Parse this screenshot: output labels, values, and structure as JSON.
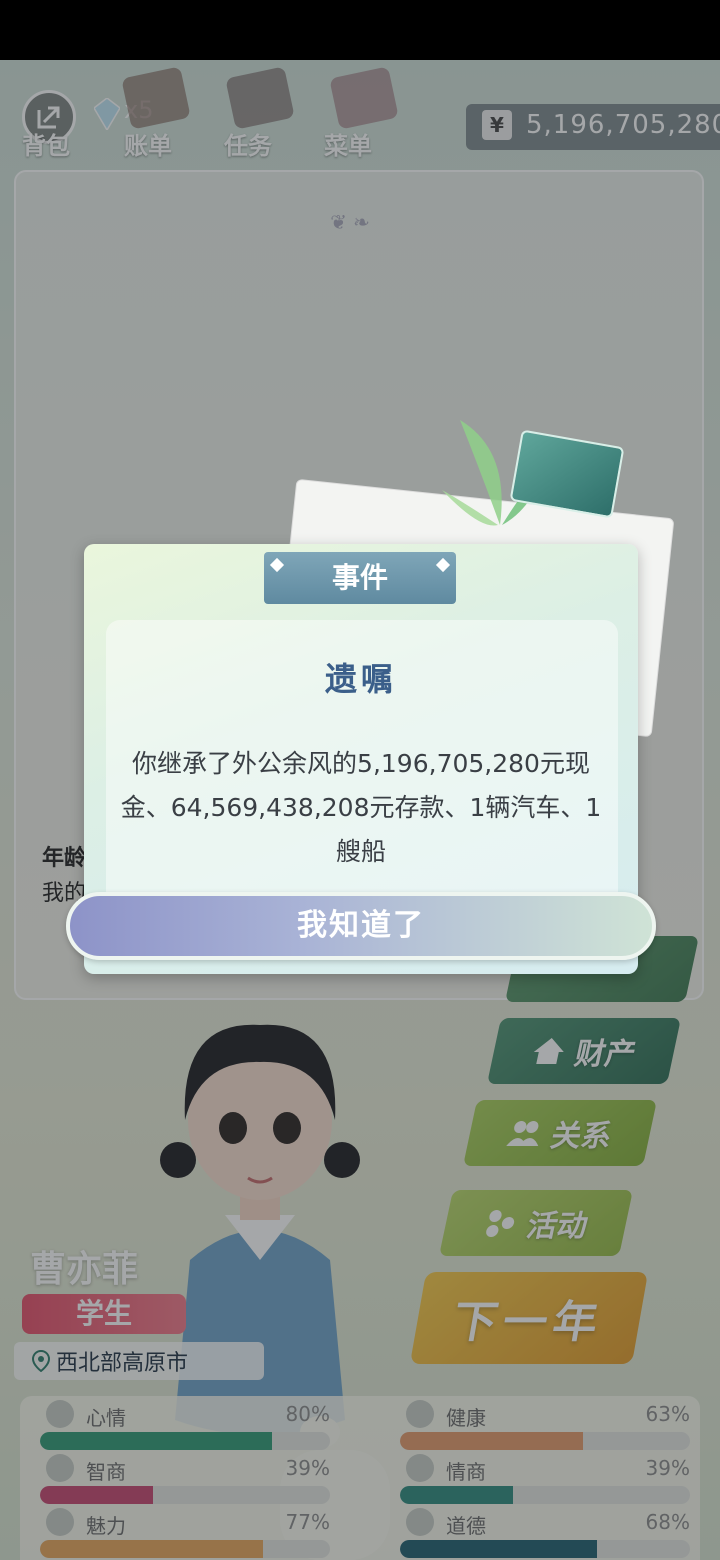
{
  "topbar": {
    "gem_count": "x5",
    "nav": [
      {
        "label": "背包"
      },
      {
        "label": "账单"
      },
      {
        "label": "任务"
      },
      {
        "label": "菜单"
      }
    ],
    "money_symbol": "¥",
    "money": "5,196,705,280"
  },
  "profile": {
    "age_label": "年龄",
    "age_desc": "我的"
  },
  "side_buttons": {
    "asset": "财产",
    "relation": "关系",
    "activity": "活动",
    "next_year": "下一年"
  },
  "character": {
    "name": "曹亦菲",
    "role": "学生",
    "location": "西北部高原市"
  },
  "stats": [
    {
      "label": "心情",
      "value": "80%",
      "level": 0.8,
      "color": "#2f9a74"
    },
    {
      "label": "健康",
      "value": "63%",
      "level": 0.63,
      "color": "#e49a6a"
    },
    {
      "label": "智商",
      "value": "39%",
      "level": 0.39,
      "color": "#c7466e"
    },
    {
      "label": "情商",
      "value": "39%",
      "level": 0.39,
      "color": "#2e8a7c"
    },
    {
      "label": "魅力",
      "value": "77%",
      "level": 0.77,
      "color": "#e7a55a"
    },
    {
      "label": "道德",
      "value": "68%",
      "level": 0.68,
      "color": "#1f5f6e"
    }
  ],
  "dialog": {
    "tab": "事件",
    "title": "遗嘱",
    "body": "你继承了外公余风的5,196,705,280元现金、64,569,438,208元存款、1辆汽车、1艘船",
    "button": "我知道了"
  }
}
